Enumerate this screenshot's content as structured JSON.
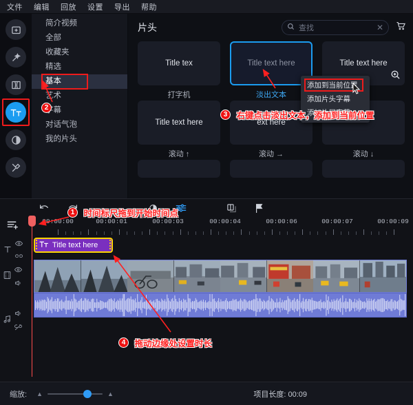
{
  "menubar": {
    "items": [
      {
        "label": "文件"
      },
      {
        "label": "编辑"
      },
      {
        "label": "回放"
      },
      {
        "label": "设置"
      },
      {
        "label": "导出"
      },
      {
        "label": "帮助"
      }
    ]
  },
  "rail": {
    "items": [
      {
        "name": "import-media-icon",
        "label": "导入媒体"
      },
      {
        "name": "magic-wand-icon",
        "label": "特效"
      },
      {
        "name": "transition-icon",
        "label": "转场"
      },
      {
        "name": "title-text-icon",
        "label": "字幕",
        "active": true
      },
      {
        "name": "color-filter-icon",
        "label": "滤镜"
      },
      {
        "name": "tools-icon",
        "label": "工具"
      }
    ]
  },
  "categories": {
    "items": [
      {
        "label": "简介视频",
        "selected": false
      },
      {
        "label": "全部",
        "selected": false
      },
      {
        "label": "收藏夹",
        "selected": false
      },
      {
        "label": "精选",
        "selected": false
      },
      {
        "label": "基本",
        "selected": true
      },
      {
        "label": "艺术",
        "selected": false
      },
      {
        "label": "字幕",
        "selected": false
      },
      {
        "label": "对话气泡",
        "selected": false
      },
      {
        "label": "我的片头",
        "selected": false
      }
    ]
  },
  "content": {
    "panel_title": "片头",
    "search": {
      "placeholder": "查找",
      "value": "",
      "icon": "search-icon",
      "clear_icon": "clear-icon"
    },
    "cart_icon": "cart-icon",
    "row1": [
      {
        "preview_text": "Title tex",
        "label": "打字机",
        "selected": false
      },
      {
        "preview_text": "Title text here",
        "label": "淡出文本",
        "selected": true
      },
      {
        "preview_text": "Title text here",
        "label": "",
        "selected": false,
        "magnifier": "zoom-in-icon"
      }
    ],
    "row2": [
      {
        "preview_text": "Title text here",
        "label": "滚动 ↑",
        "selected": false
      },
      {
        "preview_text": "ext here",
        "label": "滚动 →",
        "selected": false
      },
      {
        "preview_text": "",
        "label": "滚动 ↓",
        "selected": false
      }
    ],
    "row3": [
      {
        "preview_text": "",
        "label": "",
        "selected": false
      },
      {
        "preview_text": "",
        "label": "",
        "selected": false
      },
      {
        "preview_text": "",
        "label": "",
        "selected": false
      }
    ]
  },
  "context_menu": {
    "items": [
      {
        "label": "添加到当前位置",
        "highlighted": true
      },
      {
        "label": "添加片头字幕",
        "highlighted": false
      },
      {
        "label": "添加片尾字幕",
        "highlighted": false
      }
    ]
  },
  "timeline": {
    "toolbar": [
      {
        "name": "undo-icon",
        "blue": false
      },
      {
        "name": "redo-icon",
        "blue": false
      },
      {
        "name": "contrast-icon",
        "blue": false
      },
      {
        "name": "adjust-sliders-icon",
        "blue": true
      },
      {
        "name": "split-clip-icon",
        "blue": false
      },
      {
        "name": "marker-flag-icon",
        "blue": false
      }
    ],
    "add_track_icon": "add-track-icon",
    "ruler_labels": [
      "00:00:00",
      "00:00:01",
      "00:00:03",
      "00:00:04",
      "00:00:06",
      "00:00:07",
      "00:00:09"
    ],
    "tracks": [
      {
        "name": "text-track",
        "icon": "text-track-icon",
        "toggles": [
          "eye-icon",
          "link-icon"
        ]
      },
      {
        "name": "video-track",
        "icon": "film-track-icon",
        "toggles": [
          "eye-icon",
          "speaker-icon"
        ]
      },
      {
        "name": "audio-track",
        "icon": "music-note-icon",
        "toggles": [
          "speaker-icon",
          "unlink-icon"
        ]
      }
    ],
    "title_clip": {
      "text": "Title text here",
      "icon": "title-text-icon",
      "selected": true
    }
  },
  "bottombar": {
    "zoom_label": "缩放:",
    "zoom_value": 65,
    "zoom_out_icon": "zoom-out-icon",
    "zoom_in_icon": "zoom-in-icon",
    "project_length_label": "项目长度:",
    "project_length_value": "00:09"
  },
  "annotations": [
    {
      "badge": "1",
      "text": "时间标尺拖到开始时间点"
    },
    {
      "badge": "2",
      "text": ""
    },
    {
      "badge": "3",
      "text": "右键点击淡出文本，添加到当前位置"
    },
    {
      "badge": "4",
      "text": "拖动边缘处设置时长"
    }
  ],
  "colors": {
    "accent_blue": "#1b9cf0",
    "annotation_red": "#ff2020",
    "title_clip_purple": "#7a2fbf",
    "selection_yellow": "#ffd400",
    "audio_blue": "#6f7bd6",
    "playhead_red": "#ff4b4b"
  }
}
